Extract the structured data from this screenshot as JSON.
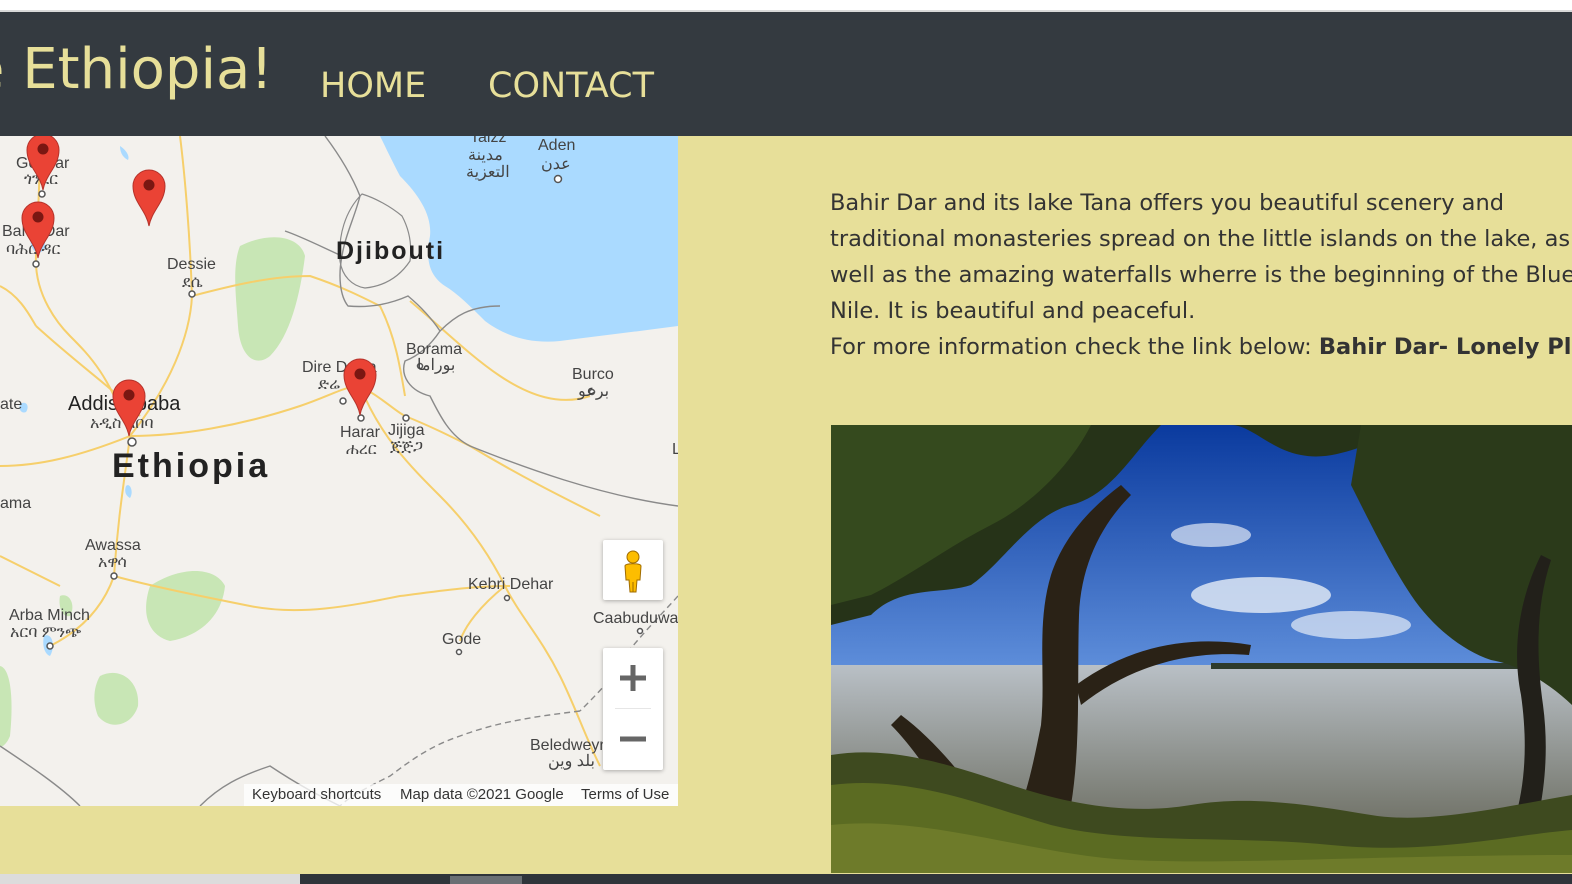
{
  "header": {
    "brand": "e Ethiopia!",
    "nav": [
      {
        "label": "HOME"
      },
      {
        "label": "CONTACT"
      }
    ]
  },
  "map": {
    "labels": {
      "taizz": "Taizz",
      "taizz_ar1": "مدينة",
      "taizz_ar2": "التعزية",
      "aden": "Aden",
      "aden_ar": "عدن",
      "gondar": "Gondar",
      "gondar_am": "ጎንደር",
      "bahir_dar": "Bahir Dar",
      "bahir_dar_am": "ባሕር ዳር",
      "dessie": "Dessie",
      "dessie_am": "ደሴ",
      "djibouti": "Djibouti",
      "dire_dawa": "Dire Dawa",
      "dire_dawa_am": "ድሬ",
      "borama": "Borama",
      "borama_ar": "بوراما",
      "burco": "Burco",
      "burco_ar": "برعو",
      "addis_ababa": "Addis Ababa",
      "addis_ababa_am": "አዲስ አበባ",
      "harar": "Harar",
      "harar_am": "ሐረር",
      "jijiga": "Jijiga",
      "jijiga_am": "ጅጅጋ",
      "ethiopia": "Ethiopia",
      "ate": "ate",
      "ama": "ama",
      "awassa": "Awassa",
      "awassa_am": "አዋሳ",
      "arba_minch": "Arba Minch",
      "arba_minch_am": "አርባ ምንጭ",
      "kebri_dehar": "Kebri Dehar",
      "caabuduwaaq": "Caabuduwaaq",
      "gode": "Gode",
      "beledweyne": "Beledweyne",
      "beledweyne_ar": "بلد وين",
      "l": "L"
    },
    "controls": {
      "zoom_in": "+",
      "zoom_out": "−"
    },
    "attribution": {
      "shortcuts": "Keyboard shortcuts",
      "data": "Map data ©2021 Google",
      "terms": "Terms of Use"
    },
    "colors": {
      "water": "#aadaff",
      "land": "#f3f1ed",
      "park": "#c8e6b5",
      "road": "#f9d67a",
      "border": "#7d7d7d",
      "marker": "#ea4335"
    }
  },
  "content": {
    "description_lines": [
      "Bahir Dar and its lake Tana offers you beautiful scenery and",
      "traditional monasteries spread on the little islands on the lake, as",
      "well as the amazing waterfalls wherre is the beginning of the Blue",
      "Nile. It is beautiful and peaceful."
    ],
    "more_info": "For more information check the link below: ",
    "link_label": "Bahir Dar- Lonely Planet"
  },
  "theme": {
    "background": "#e7df99",
    "navbar": "#343a40",
    "accent": "#e7df99"
  }
}
